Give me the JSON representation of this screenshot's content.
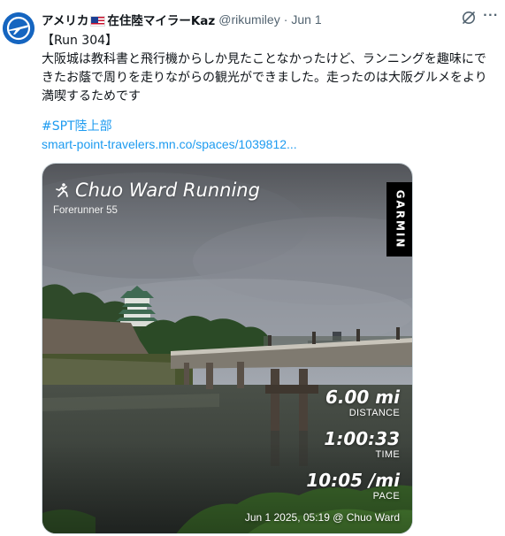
{
  "tweet": {
    "author": {
      "display_name_part1": "アメリカ",
      "flag": "us-flag-emoji",
      "display_name_part2": "在住陸マイラーKaz",
      "handle": "@rikumiley",
      "separator": "·",
      "date": "Jun 1"
    },
    "icons": {
      "grok": "grok-icon",
      "more": "more-icon",
      "more_glyph": "···"
    },
    "text_line1": "【Run 304】",
    "text_line2": "大阪城は教科書と飛行機からしか見たことなかったけど、ランニングを趣味にできたお蔭で周りを走りながらの観光ができました。走ったのは大阪グルメをより満喫するためです",
    "hashtag": "#SPT陸上部",
    "url": "smart-point-travelers.mn.co/spaces/1039812..."
  },
  "media": {
    "activity_title": "Chuo Ward Running",
    "device": "Forerunner 55",
    "brand": "GARMIN",
    "stats": {
      "distance_value": "6.00 mi",
      "distance_label": "DISTANCE",
      "time_value": "1:00:33",
      "time_label": "TIME",
      "pace_value": "10:05 /mi",
      "pace_label": "PACE"
    },
    "stamp": "Jun 1 2025, 05:19 @ Chuo Ward"
  },
  "colors": {
    "link": "#1d9bf0",
    "secondary_text": "#536471",
    "avatar_bg": "#1565c0"
  }
}
